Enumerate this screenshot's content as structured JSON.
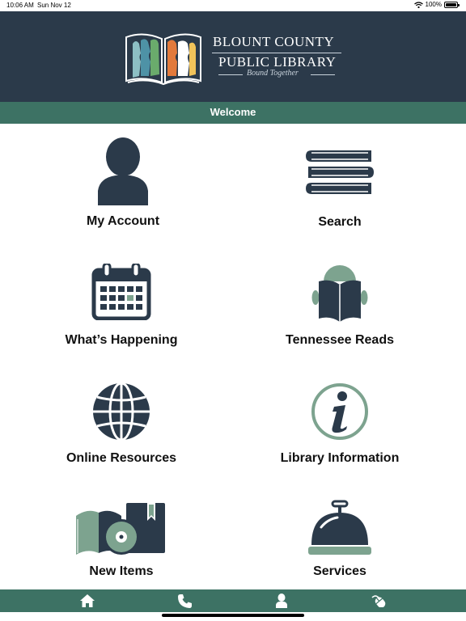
{
  "status_bar": {
    "time": "10:06 AM",
    "date": "Sun Nov 12",
    "battery": "100%",
    "battery_level": 1.0
  },
  "header": {
    "logo_line1": "BLOUNT COUNTY",
    "logo_line2": "PUBLIC LIBRARY",
    "tagline": "Bound Together"
  },
  "welcome": "Welcome",
  "tiles": [
    {
      "label": "My Account",
      "icon": "person-icon"
    },
    {
      "label": "Search",
      "icon": "books-stack-icon"
    },
    {
      "label": "What’s Happening",
      "icon": "calendar-icon"
    },
    {
      "label": "Tennessee Reads",
      "icon": "reader-icon"
    },
    {
      "label": "Online Resources",
      "icon": "globe-icon"
    },
    {
      "label": "Library Information",
      "icon": "info-icon"
    },
    {
      "label": "New Items",
      "icon": "media-icon"
    },
    {
      "label": "Services",
      "icon": "service-bell-icon"
    }
  ],
  "tabbar": [
    {
      "icon": "home-icon"
    },
    {
      "icon": "phone-icon"
    },
    {
      "icon": "user-icon"
    },
    {
      "icon": "mouse-icon"
    }
  ],
  "colors": {
    "navy": "#2b3a4a",
    "green": "#3d7264",
    "sage": "#7da38f"
  }
}
